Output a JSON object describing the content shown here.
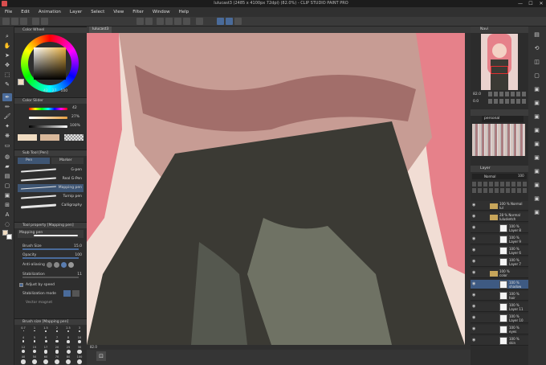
{
  "window": {
    "title": "lulucast3 (2485 x 4100px 72dpi) (82.0%) - CLIP STUDIO PAINT PRO",
    "controls": [
      "—",
      "☐",
      "✕"
    ]
  },
  "menu": [
    "File",
    "Edit",
    "Animation",
    "Layer",
    "Select",
    "View",
    "Filter",
    "Window",
    "Help"
  ],
  "color_wheel": {
    "title": "Color Wheel",
    "values": [
      "42",
      "27",
      "100"
    ]
  },
  "color_slider": {
    "title": "Color Slider",
    "values": [
      "42",
      "27%",
      "100%"
    ]
  },
  "sub_tool": {
    "title": "Sub Tool [Pen]",
    "tabs": [
      "Pen",
      "Marker"
    ],
    "brushes": [
      "G-pen",
      "Real G-Pen",
      "Mapping pen",
      "Turnip pen",
      "Calligraphy"
    ],
    "selected_index": 2
  },
  "tool_property": {
    "title": "Tool property [Mapping pen]",
    "brush_name": "Mapping pen",
    "rows": [
      {
        "label": "Brush Size",
        "value": "15.0"
      },
      {
        "label": "Opacity",
        "value": "100"
      },
      {
        "label": "Anti-aliasing",
        "value": ""
      },
      {
        "label": "Stabilization",
        "value": "11"
      },
      {
        "label": "Adjust by speed",
        "value": ""
      },
      {
        "label": "Stabilization mode",
        "value": ""
      },
      {
        "label": "Vector magnet",
        "value": ""
      }
    ]
  },
  "brush_size": {
    "title": "Brush size [Mapping pen]",
    "sizes": [
      "0.7",
      "1",
      "1.5",
      "2",
      "2.5",
      "3",
      "4",
      "5",
      "6",
      "7",
      "8",
      "10",
      "12",
      "15",
      "17",
      "20",
      "25",
      "30",
      "40",
      "50",
      "60",
      "70",
      "80",
      "100"
    ]
  },
  "canvas": {
    "tab": "lulucast3",
    "zoom": "82.0",
    "colors": {
      "skin": "#f1ddd4",
      "shirt": "#c79c94",
      "shirt_shadow": "#a26e6a",
      "skirt": "#3b3a34",
      "skirt_light": "#6f7264",
      "hair": "#e6818a"
    }
  },
  "navigator": {
    "title": "Navi",
    "zoom": "82.0",
    "rotation": "0.0"
  },
  "swatch": {
    "title": "personal"
  },
  "layer_panel": {
    "title": "Layer",
    "blend": "Normal",
    "opacity": "100",
    "layers": [
      {
        "line1": "100 % Normal",
        "line2": "lul",
        "folder": true
      },
      {
        "line1": "28 % Normal",
        "line2": "lulusketch",
        "folder": true
      },
      {
        "line1": "100 %",
        "line2": "Layer 8",
        "folder": false
      },
      {
        "line1": "100 %",
        "line2": "Layer 9",
        "folder": false
      },
      {
        "line1": "100 %",
        "line2": "Layer 6",
        "folder": false
      },
      {
        "line1": "100 %",
        "line2": "Layer 7",
        "folder": false
      },
      {
        "line1": "100 %",
        "line2": "color",
        "folder": true
      },
      {
        "line1": "100 %",
        "line2": "shadow",
        "folder": false
      },
      {
        "line1": "100 %",
        "line2": "hair",
        "folder": false
      },
      {
        "line1": "100 %",
        "line2": "Layer 11",
        "folder": false
      },
      {
        "line1": "100 %",
        "line2": "Layer 10",
        "folder": false
      },
      {
        "line1": "100 %",
        "line2": "eyes",
        "folder": false
      },
      {
        "line1": "100 %",
        "line2": "skin",
        "folder": false
      }
    ],
    "selected_index": 7
  }
}
